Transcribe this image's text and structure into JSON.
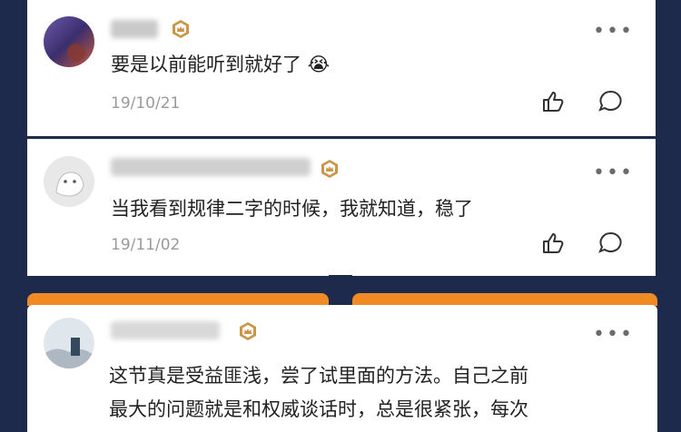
{
  "comments": [
    {
      "text": "要是以前能听到就好了 😭",
      "date": "19/10/21"
    },
    {
      "text": "当我看到规律二字的时候，我就知道，稳了",
      "date": "19/11/02"
    },
    {
      "line1": "这节真是受益匪浅，尝了试里面的方法。自己之前",
      "line2": "最大的问题就是和权威谈话时，总是很紧张，每次"
    }
  ],
  "more_icon": "•••",
  "icons": [
    "avatar",
    "vip-badge-icon",
    "more-icon",
    "like-icon",
    "comment-icon"
  ],
  "colors": {
    "background": "#1d2a4b",
    "accent": "#f08a24",
    "badge": "#c9964a"
  }
}
